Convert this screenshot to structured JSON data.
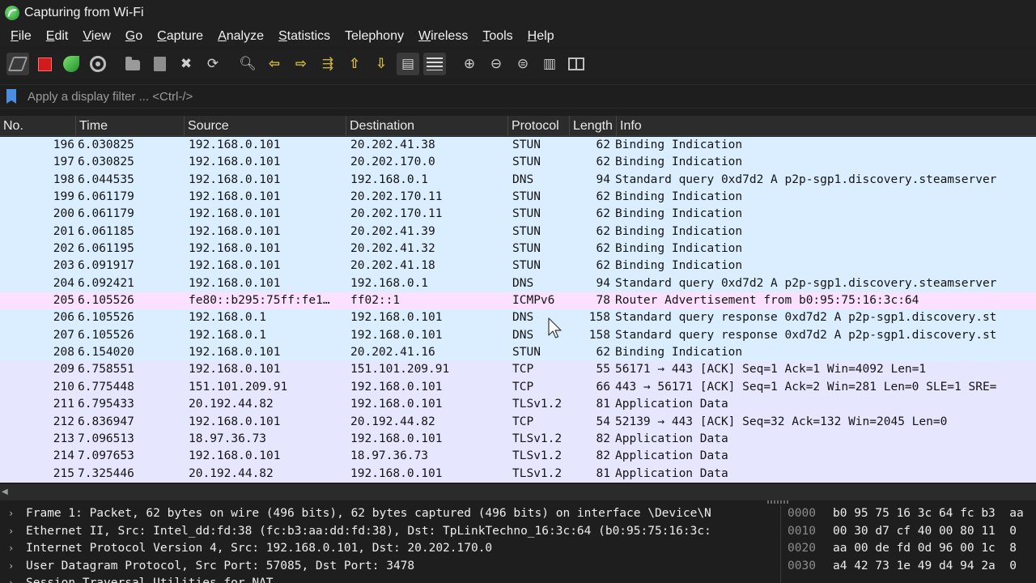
{
  "window": {
    "title": "Capturing from Wi-Fi"
  },
  "menu": [
    {
      "u": "F",
      "rest": "ile"
    },
    {
      "u": "E",
      "rest": "dit"
    },
    {
      "u": "V",
      "rest": "iew"
    },
    {
      "u": "G",
      "rest": "o"
    },
    {
      "u": "C",
      "rest": "apture"
    },
    {
      "u": "A",
      "rest": "nalyze"
    },
    {
      "u": "S",
      "rest": "tatistics"
    },
    {
      "u": "",
      "rest": "Telephony"
    },
    {
      "u": "W",
      "rest": "ireless"
    },
    {
      "u": "T",
      "rest": "ools"
    },
    {
      "u": "H",
      "rest": "elp"
    }
  ],
  "toolbar": {
    "icons": [
      "start-capture-icon",
      "stop-capture-icon",
      "restart-capture-icon",
      "capture-options-icon",
      "open-file-icon",
      "save-file-icon",
      "close-file-icon",
      "reload-file-icon",
      "find-packet-icon",
      "go-back-icon",
      "go-forward-icon",
      "go-to-packet-icon",
      "first-packet-icon",
      "last-packet-icon",
      "auto-scroll-icon",
      "colorize-icon",
      "zoom-in-icon",
      "zoom-out-icon",
      "normal-size-icon",
      "resize-columns-icon"
    ]
  },
  "filter": {
    "placeholder": "Apply a display filter ... <Ctrl-/>"
  },
  "columns": {
    "no": "No.",
    "time": "Time",
    "source": "Source",
    "destination": "Destination",
    "protocol": "Protocol",
    "length": "Length",
    "info": "Info"
  },
  "colors": {
    "udp_row": "#daeeff",
    "tcp_row": "#e7e6ff",
    "icmpv6_row": "#fce0ff"
  },
  "packets": [
    {
      "no": "196",
      "time": "6.030825",
      "src": "192.168.0.101",
      "dst": "20.202.41.38",
      "proto": "STUN",
      "len": "62",
      "info": "Binding Indication",
      "kind": "udp"
    },
    {
      "no": "197",
      "time": "6.030825",
      "src": "192.168.0.101",
      "dst": "20.202.170.0",
      "proto": "STUN",
      "len": "62",
      "info": "Binding Indication",
      "kind": "udp"
    },
    {
      "no": "198",
      "time": "6.044535",
      "src": "192.168.0.101",
      "dst": "192.168.0.1",
      "proto": "DNS",
      "len": "94",
      "info": "Standard query 0xd7d2 A p2p-sgp1.discovery.steamserver",
      "kind": "udp"
    },
    {
      "no": "199",
      "time": "6.061179",
      "src": "192.168.0.101",
      "dst": "20.202.170.11",
      "proto": "STUN",
      "len": "62",
      "info": "Binding Indication",
      "kind": "udp"
    },
    {
      "no": "200",
      "time": "6.061179",
      "src": "192.168.0.101",
      "dst": "20.202.170.11",
      "proto": "STUN",
      "len": "62",
      "info": "Binding Indication",
      "kind": "udp"
    },
    {
      "no": "201",
      "time": "6.061185",
      "src": "192.168.0.101",
      "dst": "20.202.41.39",
      "proto": "STUN",
      "len": "62",
      "info": "Binding Indication",
      "kind": "udp"
    },
    {
      "no": "202",
      "time": "6.061195",
      "src": "192.168.0.101",
      "dst": "20.202.41.32",
      "proto": "STUN",
      "len": "62",
      "info": "Binding Indication",
      "kind": "udp"
    },
    {
      "no": "203",
      "time": "6.091917",
      "src": "192.168.0.101",
      "dst": "20.202.41.18",
      "proto": "STUN",
      "len": "62",
      "info": "Binding Indication",
      "kind": "udp"
    },
    {
      "no": "204",
      "time": "6.092421",
      "src": "192.168.0.101",
      "dst": "192.168.0.1",
      "proto": "DNS",
      "len": "94",
      "info": "Standard query 0xd7d2 A p2p-sgp1.discovery.steamserver",
      "kind": "udp"
    },
    {
      "no": "205",
      "time": "6.105526",
      "src": "fe80::b295:75ff:fe1…",
      "dst": "ff02::1",
      "proto": "ICMPv6",
      "len": "78",
      "info": "Router Advertisement from b0:95:75:16:3c:64",
      "kind": "icmpv6"
    },
    {
      "no": "206",
      "time": "6.105526",
      "src": "192.168.0.1",
      "dst": "192.168.0.101",
      "proto": "DNS",
      "len": "158",
      "info": "Standard query response 0xd7d2 A p2p-sgp1.discovery.st",
      "kind": "udp"
    },
    {
      "no": "207",
      "time": "6.105526",
      "src": "192.168.0.1",
      "dst": "192.168.0.101",
      "proto": "DNS",
      "len": "158",
      "info": "Standard query response 0xd7d2 A p2p-sgp1.discovery.st",
      "kind": "udp"
    },
    {
      "no": "208",
      "time": "6.154020",
      "src": "192.168.0.101",
      "dst": "20.202.41.16",
      "proto": "STUN",
      "len": "62",
      "info": "Binding Indication",
      "kind": "udp"
    },
    {
      "no": "209",
      "time": "6.758551",
      "src": "192.168.0.101",
      "dst": "151.101.209.91",
      "proto": "TCP",
      "len": "55",
      "info": "56171 → 443 [ACK] Seq=1 Ack=1 Win=4092 Len=1",
      "kind": "tcp"
    },
    {
      "no": "210",
      "time": "6.775448",
      "src": "151.101.209.91",
      "dst": "192.168.0.101",
      "proto": "TCP",
      "len": "66",
      "info": "443 → 56171 [ACK] Seq=1 Ack=2 Win=281 Len=0 SLE=1 SRE=",
      "kind": "tcp"
    },
    {
      "no": "211",
      "time": "6.795433",
      "src": "20.192.44.82",
      "dst": "192.168.0.101",
      "proto": "TLSv1.2",
      "len": "81",
      "info": "Application Data",
      "kind": "tcp"
    },
    {
      "no": "212",
      "time": "6.836947",
      "src": "192.168.0.101",
      "dst": "20.192.44.82",
      "proto": "TCP",
      "len": "54",
      "info": "52139 → 443 [ACK] Seq=32 Ack=132 Win=2045 Len=0",
      "kind": "tcp"
    },
    {
      "no": "213",
      "time": "7.096513",
      "src": "18.97.36.73",
      "dst": "192.168.0.101",
      "proto": "TLSv1.2",
      "len": "82",
      "info": "Application Data",
      "kind": "tcp"
    },
    {
      "no": "214",
      "time": "7.097653",
      "src": "192.168.0.101",
      "dst": "18.97.36.73",
      "proto": "TLSv1.2",
      "len": "82",
      "info": "Application Data",
      "kind": "tcp"
    },
    {
      "no": "215",
      "time": "7.325446",
      "src": "20.192.44.82",
      "dst": "192.168.0.101",
      "proto": "TLSv1.2",
      "len": "81",
      "info": "Application Data",
      "kind": "tcp"
    }
  ],
  "details": [
    "Frame 1: Packet, 62 bytes on wire (496 bits), 62 bytes captured (496 bits) on interface \\Device\\N",
    "Ethernet II, Src: Intel_dd:fd:38 (fc:b3:aa:dd:fd:38), Dst: TpLinkTechno_16:3c:64 (b0:95:75:16:3c:",
    "Internet Protocol Version 4, Src: 192.168.0.101, Dst: 20.202.170.0",
    "User Datagram Protocol, Src Port: 57085, Dst Port: 3478",
    "Session Traversal Utilities for NAT"
  ],
  "hex": [
    {
      "offset": "0000",
      "bytes": "b0 95 75 16 3c 64 fc b3  aa"
    },
    {
      "offset": "0010",
      "bytes": "00 30 d7 cf 40 00 80 11  0"
    },
    {
      "offset": "0020",
      "bytes": "aa 00 de fd 0d 96 00 1c  8"
    },
    {
      "offset": "0030",
      "bytes": "a4 42 73 1e 49 d4 94 2a  0"
    }
  ]
}
